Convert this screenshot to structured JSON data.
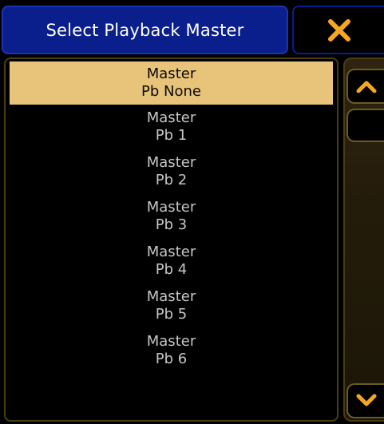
{
  "dialog": {
    "title": "Select Playback Master",
    "close_icon": "close-x-icon",
    "accent_color": "#f5a623"
  },
  "list": {
    "selected_index": 0,
    "items": [
      {
        "line1": "Master",
        "line2": "Pb None"
      },
      {
        "line1": "Master",
        "line2": "Pb 1"
      },
      {
        "line1": "Master",
        "line2": "Pb 2"
      },
      {
        "line1": "Master",
        "line2": "Pb 3"
      },
      {
        "line1": "Master",
        "line2": "Pb 4"
      },
      {
        "line1": "Master",
        "line2": "Pb 5"
      },
      {
        "line1": "Master",
        "line2": "Pb 6"
      }
    ]
  },
  "scrollbar": {
    "up_icon": "chevron-up-icon",
    "down_icon": "chevron-down-icon"
  }
}
